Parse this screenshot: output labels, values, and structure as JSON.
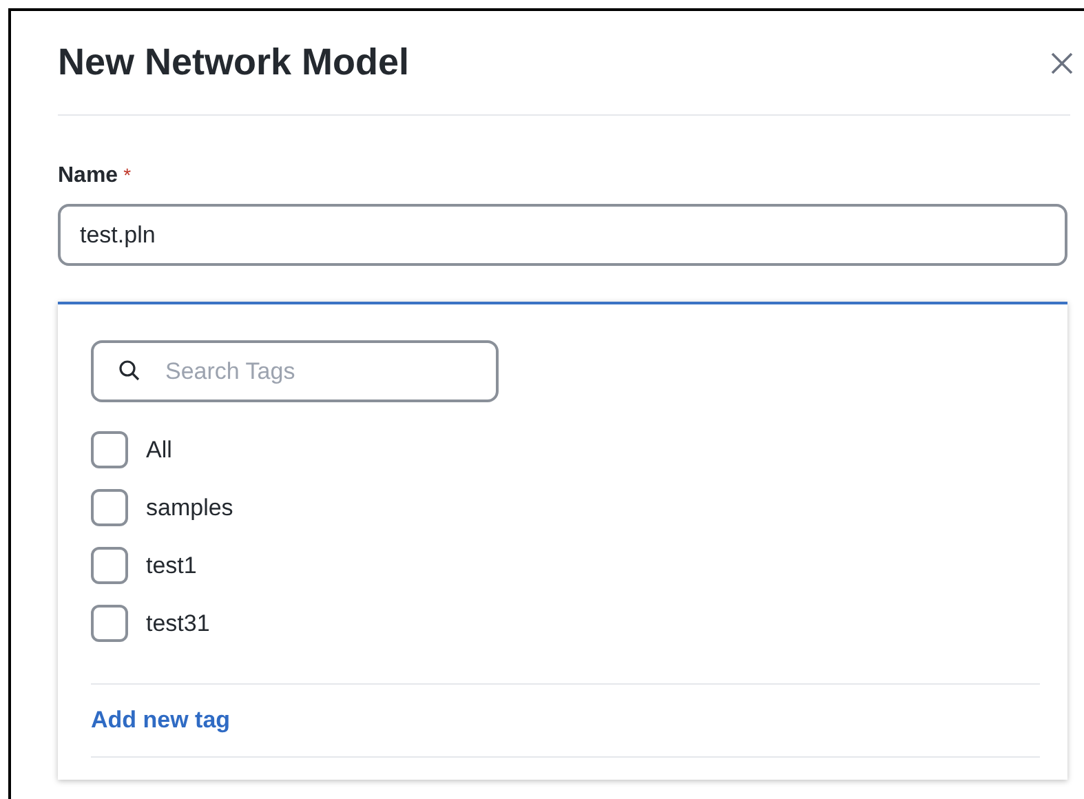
{
  "dialog": {
    "title": "New Network Model"
  },
  "name_field": {
    "label": "Name",
    "required_mark": "*",
    "value": "test.pln"
  },
  "tags": {
    "search": {
      "placeholder": "Search Tags"
    },
    "items": [
      {
        "label": "All",
        "checked": false
      },
      {
        "label": "samples",
        "checked": false
      },
      {
        "label": "test1",
        "checked": false
      },
      {
        "label": "test31",
        "checked": false
      }
    ],
    "add_link": "Add new tag"
  }
}
